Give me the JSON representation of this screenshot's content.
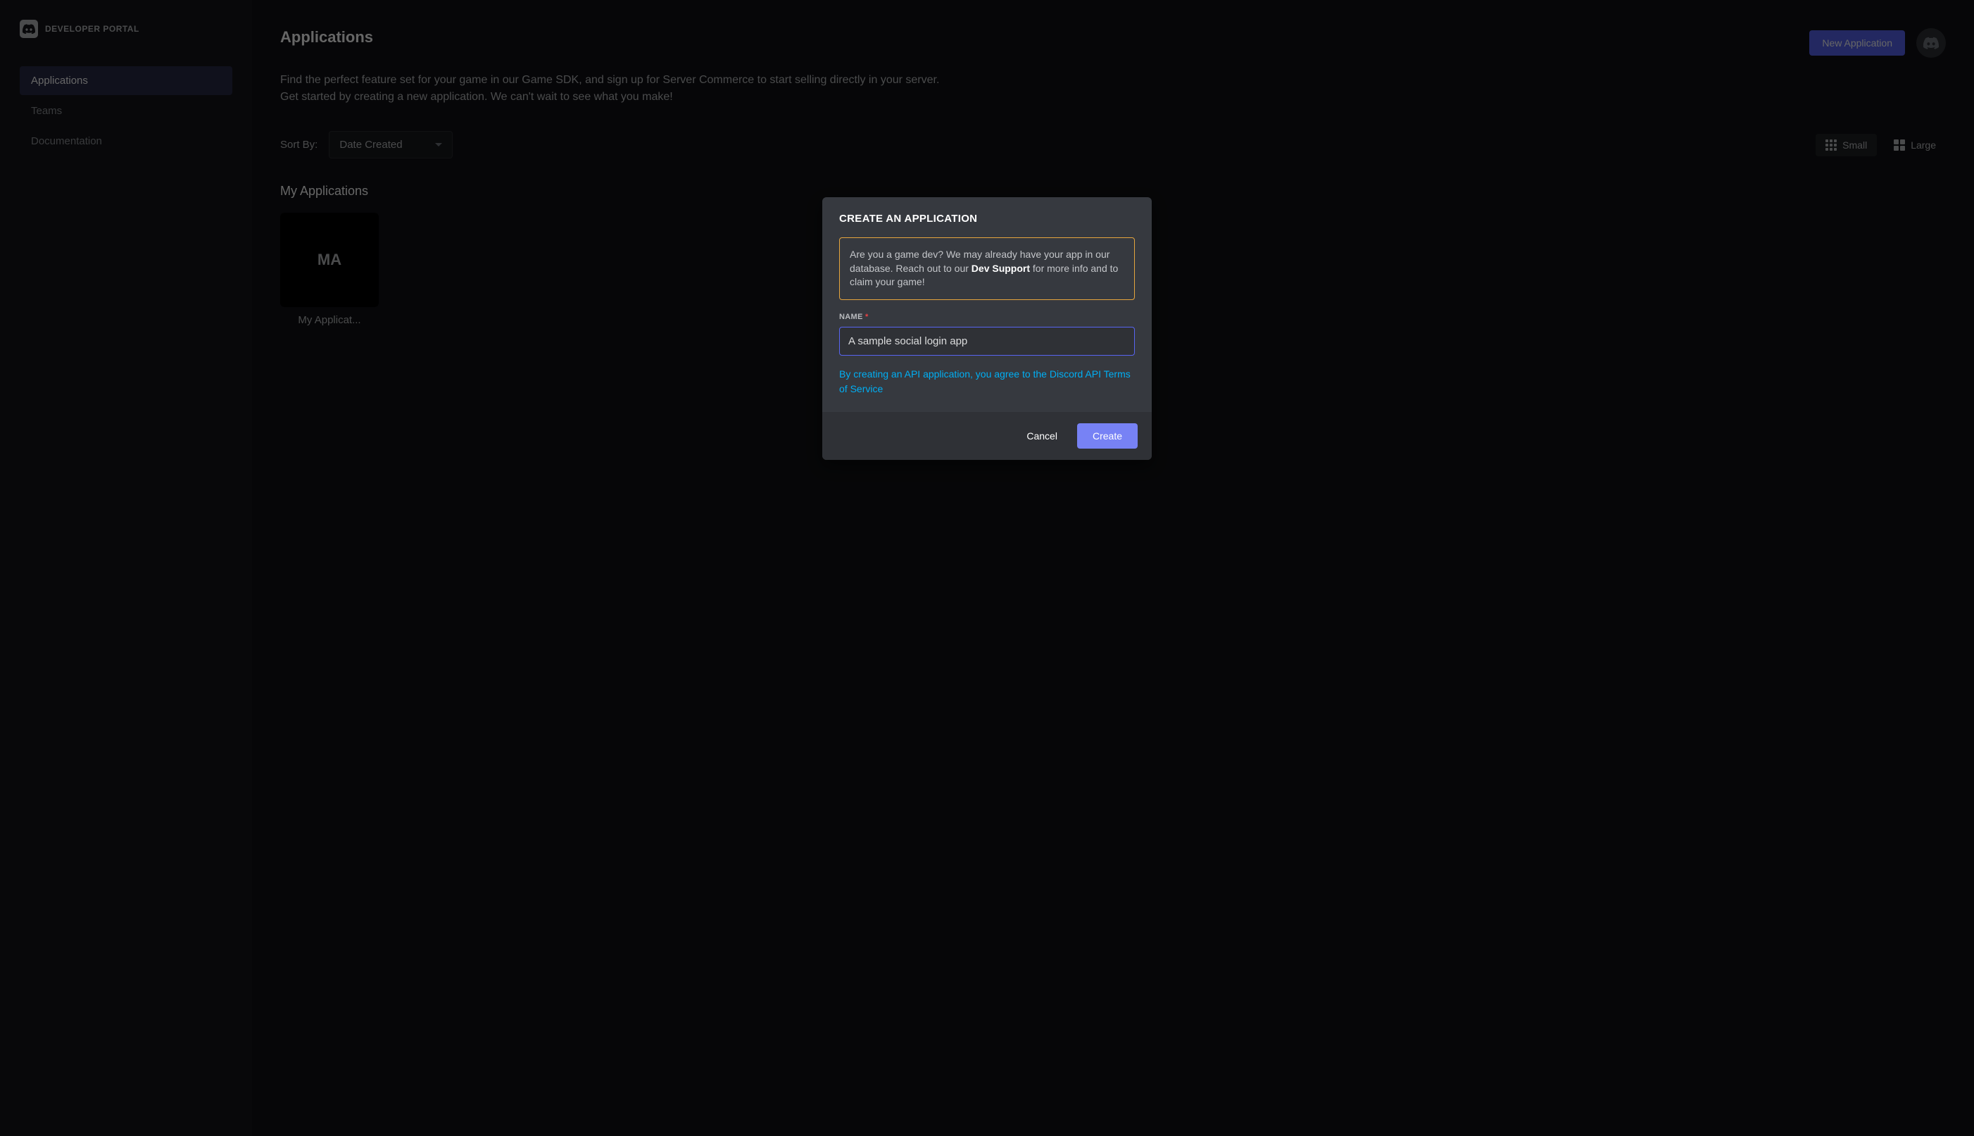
{
  "sidebar": {
    "portal_title": "DEVELOPER PORTAL",
    "nav": [
      {
        "label": "Applications",
        "active": true
      },
      {
        "label": "Teams",
        "active": false
      },
      {
        "label": "Documentation",
        "active": false
      }
    ]
  },
  "header": {
    "title": "Applications",
    "new_app_button": "New Application",
    "description": "Find the perfect feature set for your game in our Game SDK, and sign up for Server Commerce to start selling directly in your server. Get started by creating a new application. We can't wait to see what you make!"
  },
  "toolbar": {
    "sort_label": "Sort By:",
    "sort_value": "Date Created",
    "view_small": "Small",
    "view_large": "Large"
  },
  "apps_section": {
    "title": "My Applications",
    "apps": [
      {
        "thumb_text": "MA",
        "name": "My Applicat..."
      }
    ]
  },
  "modal": {
    "title": "CREATE AN APPLICATION",
    "notice_pre": "Are you a game dev? We may already have your app in our database. Reach out to our ",
    "notice_bold": "Dev Support",
    "notice_post": " for more info and to claim your game!",
    "name_label": "NAME",
    "name_value": "A sample social login app",
    "tos_text": "By creating an API application, you agree to the Discord API Terms of Service",
    "cancel": "Cancel",
    "create": "Create"
  }
}
